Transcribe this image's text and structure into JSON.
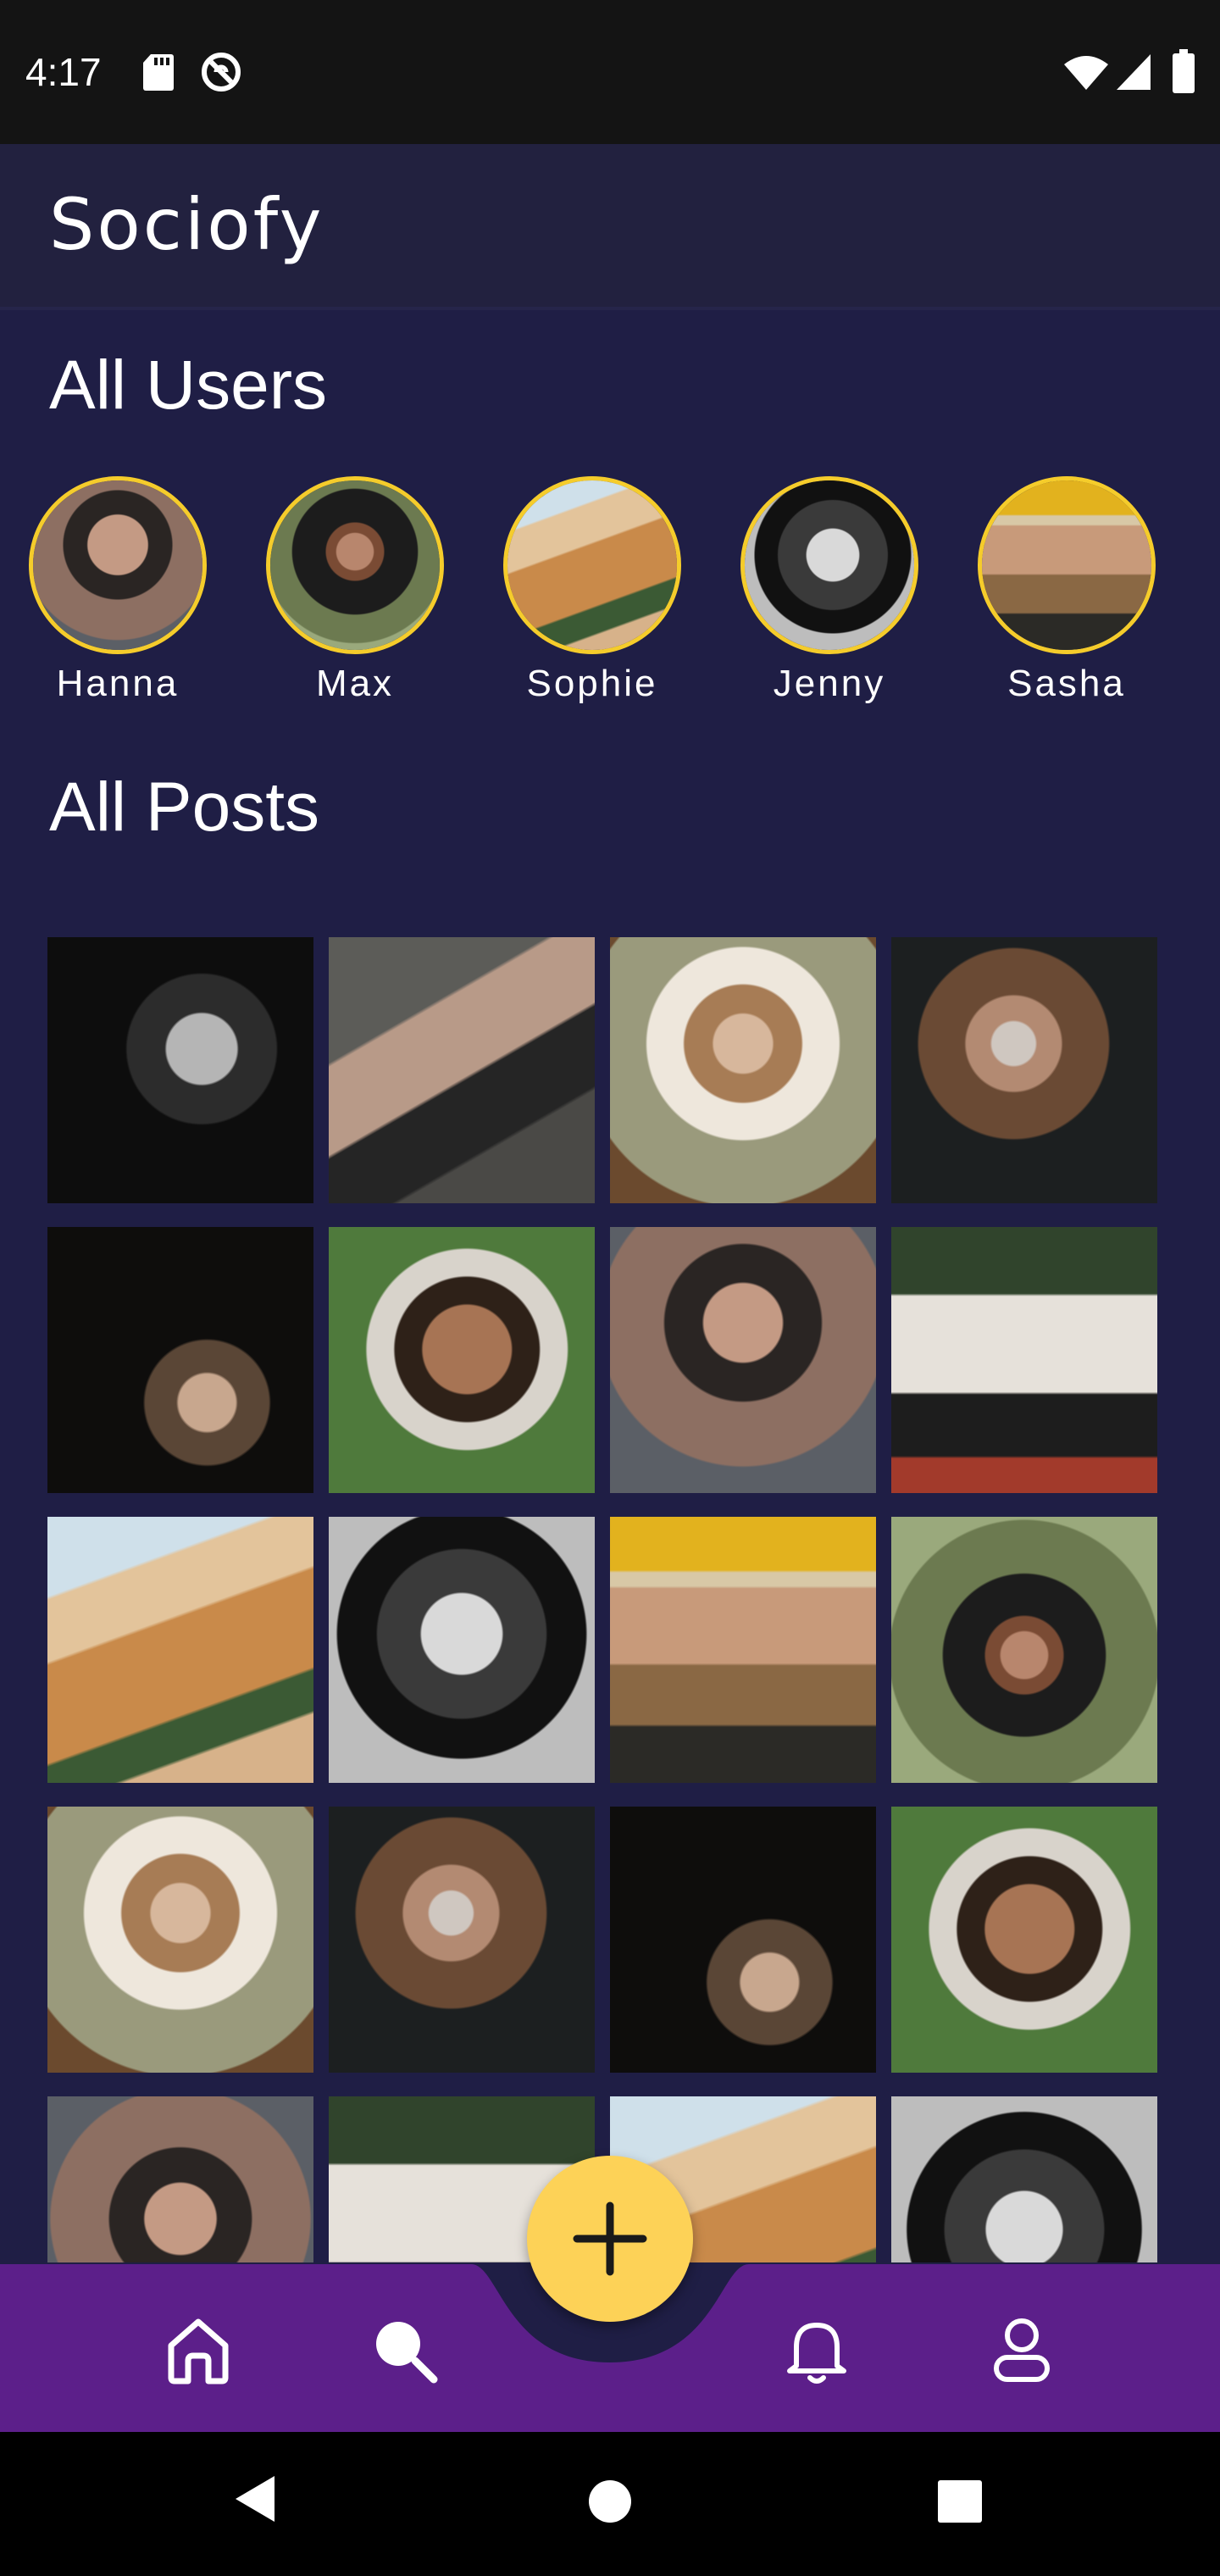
{
  "status_bar": {
    "time": "4:17",
    "icons": [
      "sd-card-icon",
      "do-not-disturb-icon",
      "wifi-icon",
      "signal-icon",
      "battery-icon"
    ]
  },
  "app": {
    "title": "Sociofy"
  },
  "users_section": {
    "title": "All Users",
    "users": [
      {
        "name": "Hanna"
      },
      {
        "name": "Max"
      },
      {
        "name": "Sophie"
      },
      {
        "name": "Jenny"
      },
      {
        "name": "Sasha"
      }
    ]
  },
  "posts_section": {
    "title": "All Posts",
    "post_count_visible": 20
  },
  "bottom_nav": {
    "items": [
      "home-icon",
      "search-icon",
      "add-icon",
      "bell-icon",
      "profile-icon"
    ],
    "active": "search"
  },
  "colors": {
    "background": "#1f1e45",
    "header": "#22213f",
    "nav_bar": "#5c1f8a",
    "accent": "#f5cc2b",
    "fab": "#fdd257"
  }
}
